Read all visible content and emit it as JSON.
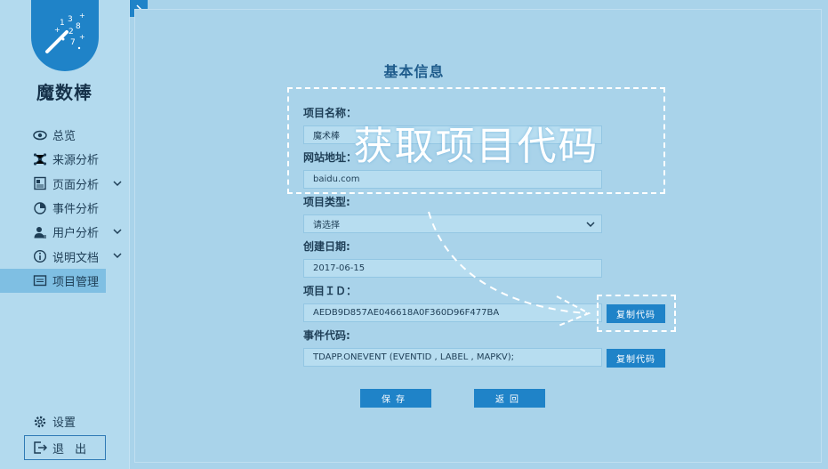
{
  "app": {
    "name": "魔数棒",
    "logo_icon": "magic-wand-icon",
    "brand_color": "#1f83c8"
  },
  "sidebar": {
    "items": [
      {
        "label": "总览",
        "icon": "eye-icon"
      },
      {
        "label": "来源分析",
        "icon": "network-icon"
      },
      {
        "label": "页面分析",
        "icon": "page-icon",
        "has_submenu": true
      },
      {
        "label": "事件分析",
        "icon": "pie-icon"
      },
      {
        "label": "用户分析",
        "icon": "user-icon",
        "has_submenu": true
      },
      {
        "label": "说明文档",
        "icon": "info-icon",
        "has_submenu": true
      },
      {
        "label": "项目管理",
        "icon": "folder-icon",
        "active": true
      }
    ],
    "settings_label": "设置",
    "logout_label": "退 出"
  },
  "main": {
    "title": "基本信息",
    "fields": {
      "project_name": {
        "label": "项目名称：",
        "value": "魔术棒"
      },
      "site_url": {
        "label": "网站地址：",
        "value": "baidu.com"
      },
      "project_type": {
        "label": "项目类型:",
        "value": "请选择"
      },
      "create_date": {
        "label": "创建日期:",
        "value": "2017-06-15"
      },
      "project_id": {
        "label": "项目ＩＤ：",
        "value": "AEDB9D857AE046618A0F360D96F477BA"
      },
      "event_code": {
        "label": "事件代码:",
        "value": "TDAPP.ONEVENT (EVENTID , LABEL , MAPKV);"
      }
    },
    "copy_code_label": "复制代码",
    "save_label": "保存",
    "back_label": "返回"
  },
  "overlay": {
    "callout_text": "获取项目代码"
  }
}
